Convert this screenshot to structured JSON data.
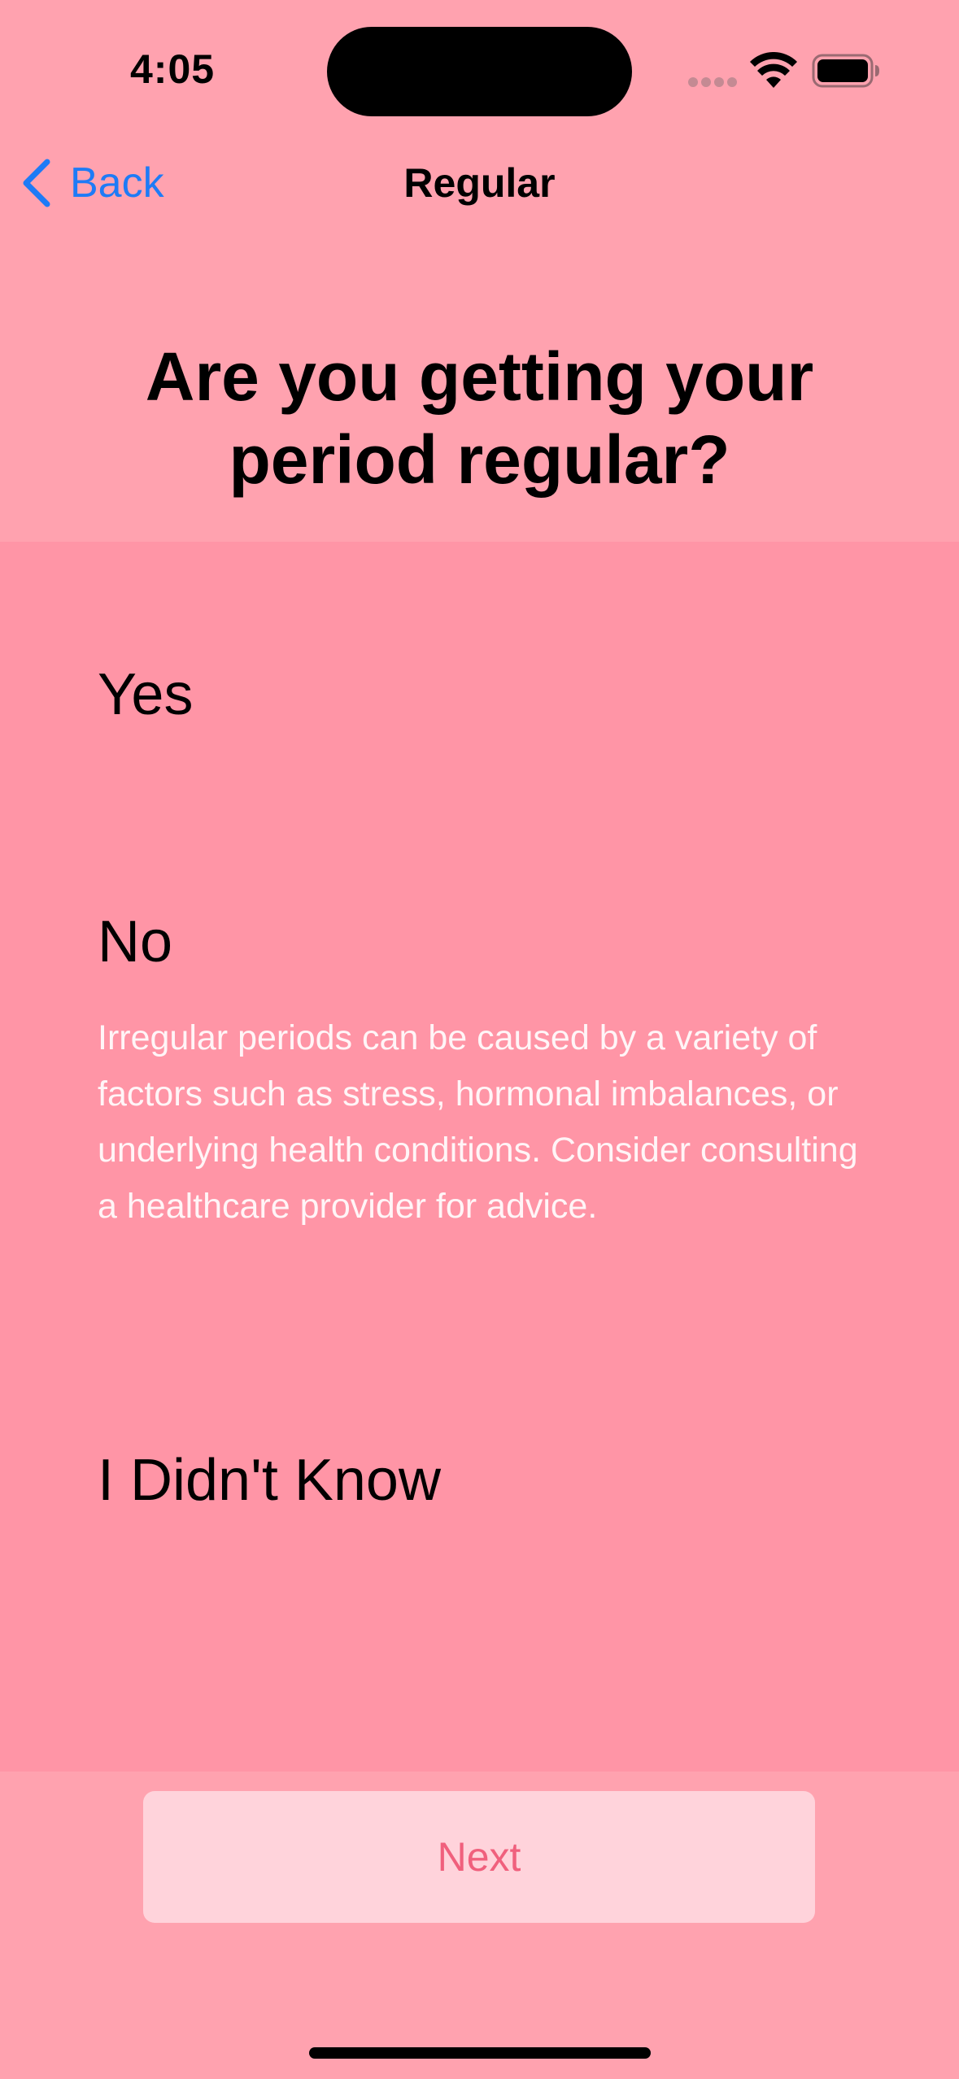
{
  "status_bar": {
    "time": "4:05"
  },
  "nav": {
    "back_label": "Back",
    "title": "Regular"
  },
  "question": "Are you getting your period regular?",
  "options": [
    {
      "label": "Yes",
      "description": ""
    },
    {
      "label": "No",
      "description": "Irregular periods can be caused by a variety of factors such as stress, hormonal imbalances, or underlying health conditions. Consider consulting a healthcare provider for advice."
    },
    {
      "label": "I Didn't Know",
      "description": ""
    }
  ],
  "next_button": {
    "label": "Next",
    "enabled": false
  },
  "colors": {
    "background": "#FFA2AF",
    "panel": "#FF95A6",
    "accent": "#1E7BF6",
    "next_bg": "#FFD3DB",
    "next_text": "#F0607D"
  },
  "icons": {
    "back": "chevron-left-icon",
    "wifi": "wifi-icon",
    "battery": "battery-icon",
    "signal": "cellular-signal-icon"
  }
}
